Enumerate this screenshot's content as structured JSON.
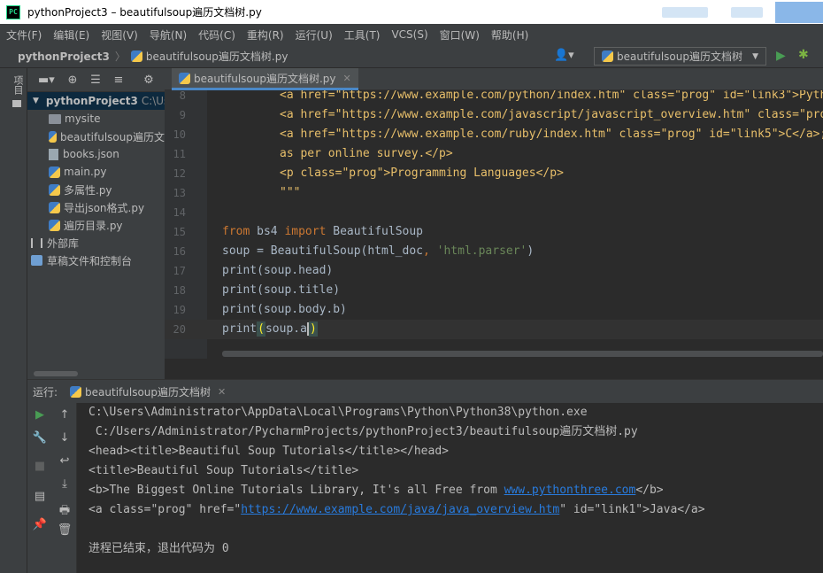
{
  "window": {
    "title": "pythonProject3 – beautifulsoup遍历文档树.py",
    "app_icon": "PC"
  },
  "menu": [
    "文件(F)",
    "编辑(E)",
    "视图(V)",
    "导航(N)",
    "代码(C)",
    "重构(R)",
    "运行(U)",
    "工具(T)",
    "VCS(S)",
    "窗口(W)",
    "帮助(H)"
  ],
  "navbar": {
    "project": "pythonProject3",
    "file": "beautifulsoup遍历文档树.py",
    "run_config": "beautifulsoup遍历文档树"
  },
  "left_stripe": {
    "project_label": "项目"
  },
  "project_tree": {
    "root": "pythonProject3",
    "root_path": "C:\\Use",
    "items": [
      {
        "label": "mysite",
        "kind": "folder"
      },
      {
        "label": "beautifulsoup遍历文",
        "kind": "py"
      },
      {
        "label": "books.json",
        "kind": "json"
      },
      {
        "label": "main.py",
        "kind": "py"
      },
      {
        "label": "多属性.py",
        "kind": "py"
      },
      {
        "label": "导出json格式.py",
        "kind": "py"
      },
      {
        "label": "遍历目录.py",
        "kind": "py"
      }
    ],
    "external_libs": "外部库",
    "scratches": "草稿文件和控制台"
  },
  "editor": {
    "tab_label": "beautifulsoup遍历文档树.py",
    "lines": [
      {
        "num": "8",
        "segments": [
          {
            "t": "<a href=\"https://www.example.com/python/index.htm\" class=\"prog\" id=\"link3\">Python</a>",
            "c": "code"
          }
        ]
      },
      {
        "num": "9",
        "segments": [
          {
            "t": "<a href=\"https://www.example.com/javascript/javascript_overview.htm\" class=\"prog\" id=",
            "c": "code"
          }
        ]
      },
      {
        "num": "10",
        "segments": [
          {
            "t": "<a href=\"https://www.example.com/ruby/index.htm\" class=\"prog\" id=\"link5\">C</a>;",
            "c": "code"
          }
        ]
      },
      {
        "num": "11",
        "segments": [
          {
            "t": "as per online survey.</p>",
            "c": "code"
          }
        ]
      },
      {
        "num": "12",
        "segments": [
          {
            "t": "<p class=\"prog\">Programming Languages</p>",
            "c": "code"
          }
        ]
      },
      {
        "num": "13",
        "segments": [
          {
            "t": "\"\"\"",
            "c": "code"
          }
        ]
      },
      {
        "num": "14",
        "segments": []
      },
      {
        "num": "15",
        "segments": [
          {
            "t": "from",
            "c": "kw"
          },
          {
            "t": " bs4 ",
            "c": "df"
          },
          {
            "t": "import",
            "c": "kw"
          },
          {
            "t": " BeautifulSoup",
            "c": "df"
          }
        ]
      },
      {
        "num": "16",
        "segments": [
          {
            "t": "soup = BeautifulSoup(html_doc",
            "c": "df"
          },
          {
            "t": ", ",
            "c": "kw"
          },
          {
            "t": "'html.parser'",
            "c": "st"
          },
          {
            "t": ")",
            "c": "df"
          }
        ]
      },
      {
        "num": "17",
        "segments": [
          {
            "t": "print(soup.head)",
            "c": "df"
          }
        ]
      },
      {
        "num": "18",
        "segments": [
          {
            "t": "print(soup.title)",
            "c": "df"
          }
        ]
      },
      {
        "num": "19",
        "segments": [
          {
            "t": "print(soup.body.b)",
            "c": "df"
          }
        ]
      },
      {
        "num": "20",
        "segments": [
          {
            "t": "print",
            "c": "df"
          },
          {
            "t": "(",
            "c": "bracket"
          },
          {
            "t": "soup.a",
            "c": "df"
          },
          {
            "t": "",
            "c": "cur"
          },
          {
            "t": ")",
            "c": "bracket"
          }
        ]
      }
    ]
  },
  "run_panel": {
    "label": "运行:",
    "tab_label": "beautifulsoup遍历文档树",
    "console": [
      [
        {
          "t": "C:\\Users\\Administrator\\AppData\\Local\\Programs\\Python\\Python38\\python.exe"
        }
      ],
      [
        {
          "t": " C:/Users/Administrator/PycharmProjects/pythonProject3/beautifulsoup遍历文档树.py"
        }
      ],
      [
        {
          "t": "<head><title>Beautiful Soup Tutorials</title></head>"
        }
      ],
      [
        {
          "t": "<title>Beautiful Soup Tutorials</title>"
        }
      ],
      [
        {
          "t": "<b>The Biggest Online Tutorials Library, It's all Free from "
        },
        {
          "t": "www.pythonthree.com",
          "link": true
        },
        {
          "t": "</b>"
        }
      ],
      [
        {
          "t": "<a class=\"prog\" href=\""
        },
        {
          "t": "https://www.example.com/java/java_overview.htm",
          "link": true
        },
        {
          "t": "\" id=\"link1\">Java</a>"
        }
      ],
      [],
      [
        {
          "t": "进程已结束，退出代码为 0"
        }
      ]
    ]
  },
  "colors": {
    "background": "#2b2b2b",
    "panel": "#3c3f41",
    "accent": "#4a88c7",
    "keyword": "#cc7832",
    "string": "#6a8759",
    "html_tag": "#e8bf6a",
    "link": "#287bde",
    "run_green": "#499c54"
  }
}
